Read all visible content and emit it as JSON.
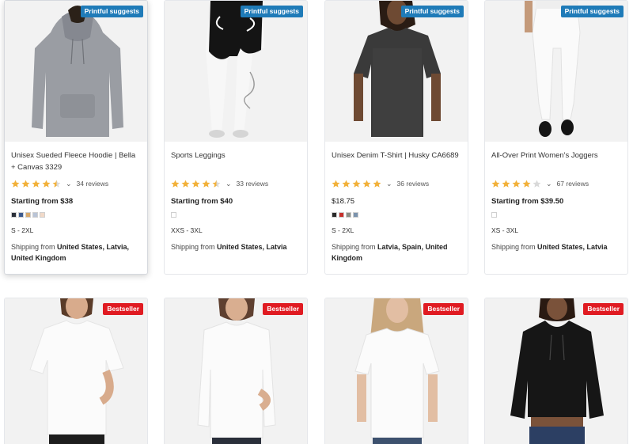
{
  "products": [
    {
      "badge": "Printful suggests",
      "title": "Unisex Sueded Fleece Hoodie | Bella + Canvas 3329",
      "rating_stars": 4.5,
      "reviews": "34 reviews",
      "price_prefix": "Starting from ",
      "price": "$38",
      "swatches": [
        "#2b2f3a",
        "#3c5a8e",
        "#d8a96b",
        "#b9c4d6",
        "#f1d9c8"
      ],
      "sizes": "S - 2XL",
      "shipping_label": "Shipping from ",
      "shipping": "United States, Latvia, United Kingdom",
      "image": "grey hoodie"
    },
    {
      "badge": "Printful suggests",
      "title": "Sports Leggings",
      "rating_stars": 4.5,
      "reviews": "33 reviews",
      "price_prefix": "Starting from ",
      "price": "$40",
      "swatches": [
        "#ffffff"
      ],
      "sizes": "XXS - 3XL",
      "shipping_label": "Shipping from ",
      "shipping": "United States, Latvia",
      "image": "black and white leggings"
    },
    {
      "badge": "Printful suggests",
      "title": "Unisex Denim T-Shirt | Husky CA6689",
      "rating_stars": 5,
      "reviews": "36 reviews",
      "price_prefix": "",
      "price": "$18.75",
      "swatches": [
        "#2a2a2a",
        "#c6302c",
        "#8a8f86",
        "#7b93ad"
      ],
      "sizes": "S - 2XL",
      "shipping_label": "Shipping from ",
      "shipping": "Latvia, Spain, United Kingdom",
      "image": "black denim t-shirt"
    },
    {
      "badge": "Printful suggests",
      "title": "All-Over Print Women's Joggers",
      "rating_stars": 4,
      "reviews": "67 reviews",
      "price_prefix": "Starting from ",
      "price": "$39.50",
      "swatches": [
        "#ffffff"
      ],
      "sizes": "XS - 3XL",
      "shipping_label": "Shipping from ",
      "shipping": "United States, Latvia",
      "image": "white joggers"
    },
    {
      "badge": "Bestseller",
      "image": "white t-shirt woman"
    },
    {
      "badge": "Bestseller",
      "image": "white long sleeve woman"
    },
    {
      "badge": "Bestseller",
      "image": "white tee blonde woman"
    },
    {
      "badge": "Bestseller",
      "image": "black cropped hoodie"
    }
  ],
  "colors": {
    "badge_blue": "#1f7bb8",
    "badge_red": "#e01b22",
    "star": "#f2b13a",
    "star_empty": "#d9d9d9"
  },
  "icons": {
    "star": "star-icon",
    "chevron": "chevron-down-icon"
  }
}
